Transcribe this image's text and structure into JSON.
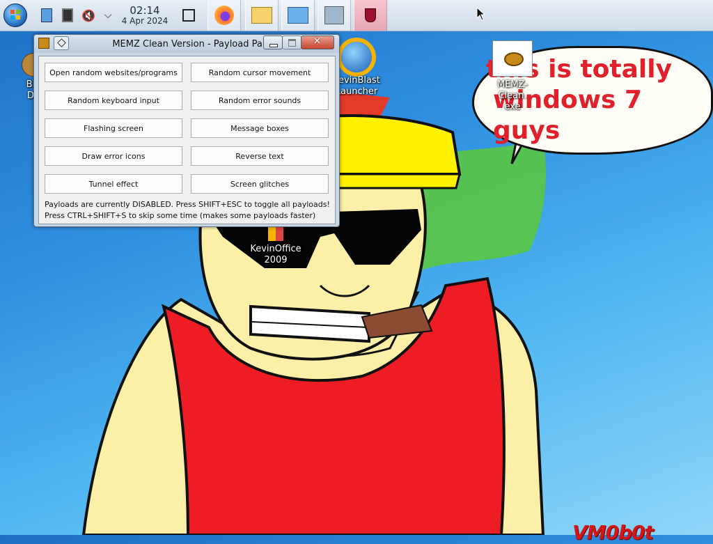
{
  "taskbar": {
    "start_icon": "windows-orb-icon",
    "tray_icons": [
      "network-icon",
      "clipboard-icon",
      "speaker-muted-icon",
      "chevron-down-icon"
    ],
    "clock_time": "02:14",
    "clock_date": "4 Apr 2024",
    "pinned_apps": [
      "show-desktop-icon",
      "firefox-icon",
      "file-explorer-icon",
      "control-panel-icon",
      "program-installer-icon",
      "wine-icon"
    ]
  },
  "desktop": {
    "icons": [
      {
        "label_line1": "Big",
        "label_line2": "De",
        "icon": "app-icon"
      },
      {
        "label_line1": "KevinBlast",
        "label_line2": "Launcher",
        "icon": "globe-star-icon"
      },
      {
        "label_line1": "MEMZ-Clean.",
        "label_line2": "exe",
        "icon": "memz-gear-icon"
      },
      {
        "label_line1": "KevinOffice",
        "label_line2": "2009",
        "icon": "office-icon"
      }
    ],
    "bubble_text_line1": "this is totally",
    "bubble_text_line2": "windows 7 guys",
    "signature": "VM0b0t",
    "colors": {
      "bubble_text": "#e0202a",
      "signature": "#d01818"
    }
  },
  "window": {
    "title": "MEMZ Clean Version - Payload Panel",
    "buttons": [
      "Open random websites/programs",
      "Random cursor movement",
      "Random keyboard input",
      "Random error sounds",
      "Flashing screen",
      "Message boxes",
      "Draw error icons",
      "Reverse text",
      "Tunnel effect",
      "Screen glitches"
    ],
    "status_line1": "Payloads are currently DISABLED. Press SHIFT+ESC to toggle all payloads!",
    "status_line2": "Press CTRL+SHIFT+S to skip some time (makes some payloads faster)"
  }
}
